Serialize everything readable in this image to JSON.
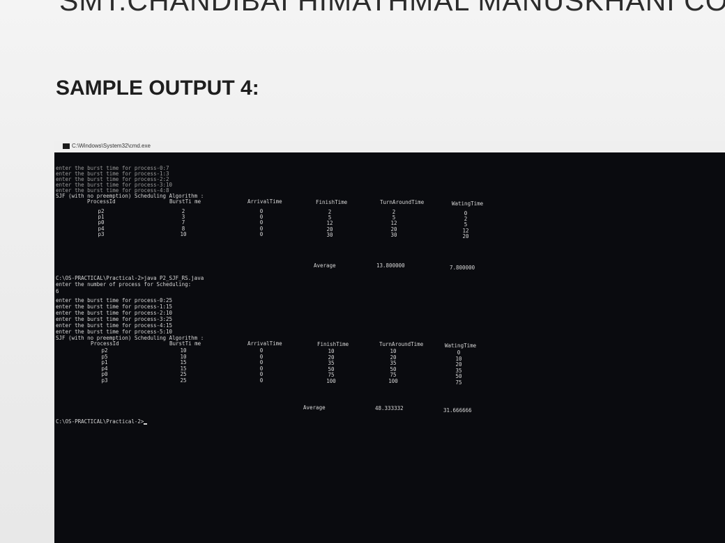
{
  "header": {
    "college": "SMT.CHANDIBAI HIMATHMAL MANUSKHANI COLL",
    "sample_title": "SAMPLE OUTPUT 4:"
  },
  "window": {
    "title": "C:\\Windows\\System32\\cmd.exe",
    "icon": "cmd-icon"
  },
  "run1": {
    "inputs": [
      "enter the burst time for process-0:7",
      "enter the burst time for process-1:3",
      "enter the burst time for process-2:2",
      "enter the burst time for process-3:10",
      "enter the burst time for process-4:8"
    ],
    "algo": "SJF (with no preemption) Scheduling Algorithm :",
    "columns": [
      "ProcessId",
      "BurstTi me",
      "ArrivalTime",
      "FinishTime",
      "TurnAroundTime",
      "WatingTime"
    ],
    "rows": [
      [
        "p2",
        "2",
        "0",
        "2",
        "2",
        "0"
      ],
      [
        "p1",
        "3",
        "0",
        "5",
        "5",
        "2"
      ],
      [
        "p0",
        "7",
        "0",
        "12",
        "12",
        "5"
      ],
      [
        "p4",
        "8",
        "0",
        "20",
        "20",
        "12"
      ],
      [
        "p3",
        "10",
        "0",
        "30",
        "30",
        "20"
      ]
    ],
    "average_label": "Average",
    "avg_tat": "13.800000",
    "avg_wt": "7.800000"
  },
  "command": "C:\\OS-PRACTICAL\\Practical-2>java P2_SJF_RS.java",
  "prompt_count": "enter the number of process for Scheduling:",
  "count_value": "6",
  "run2": {
    "inputs": [
      "enter the burst time for process-0:25",
      "enter the burst time for process-1:15",
      "enter the burst time for process-2:10",
      "enter the burst time for process-3:25",
      "enter the burst time for process-4:15",
      "enter the burst time for process-5:10"
    ],
    "algo": "SJF (with no preemption) Scheduling Algorithm :",
    "columns": [
      "ProcessId",
      "BurstTi me",
      "ArrivalTime",
      "FinishTime",
      "TurnAroundTime",
      "WatingTime"
    ],
    "rows": [
      [
        "p2",
        "10",
        "0",
        "10",
        "10",
        "0"
      ],
      [
        "p5",
        "10",
        "0",
        "20",
        "20",
        "10"
      ],
      [
        "p1",
        "15",
        "0",
        "35",
        "35",
        "20"
      ],
      [
        "p4",
        "15",
        "0",
        "50",
        "50",
        "35"
      ],
      [
        "p0",
        "25",
        "0",
        "75",
        "75",
        "50"
      ],
      [
        "p3",
        "25",
        "0",
        "100",
        "100",
        "75"
      ]
    ],
    "average_label": "Average",
    "avg_tat": "48.333332",
    "avg_wt": "31.666666"
  },
  "final_prompt": "C:\\OS-PRACTICAL\\Practical-2>"
}
